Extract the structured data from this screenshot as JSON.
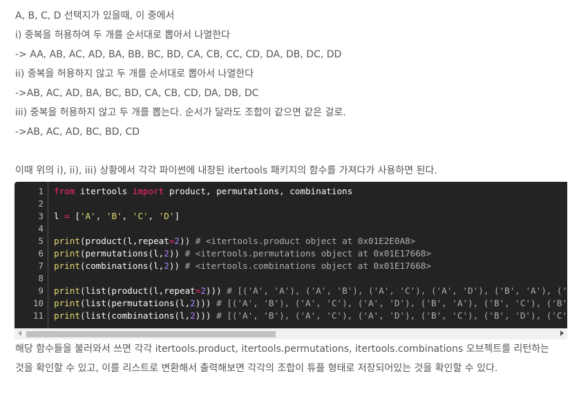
{
  "paragraphs": [
    "A, B, C, D 선택지가 있을때, 이 중에서",
    "i) 중복을 허용하여 두 개를 순서대로 뽑아서 나열한다",
    "-> AA, AB, AC, AD, BA, BB, BC, BD, CA, CB, CC, CD, DA, DB, DC, DD",
    "ii) 중복을 허용하지 않고 두 개를 순서대로 뽑아서 나열한다",
    "->AB, AC, AD, BA, BC, BD, CA, CB, CD, DA, DB, DC",
    "iii) 중복을 허용하지 않고 두 개를 뽑는다. 순서가 달라도 조합이 같으면 같은 걸로.",
    "->AB, AC, AD, BC, BD, CD",
    "이때 위의 i), ii), iii) 상황에서 각각 파이썬에 내장된 itertools 패키지의 함수를 가져다가 사용하면 된다."
  ],
  "code": {
    "line_numbers": [
      "1",
      "2",
      "3",
      "4",
      "5",
      "6",
      "7",
      "8",
      "9",
      "10",
      "11"
    ],
    "l1": {
      "kw_from": "from",
      "mod": " itertools ",
      "kw_import": "import",
      "rest": " product, permutations, combinations"
    },
    "l3": {
      "var": "l ",
      "eq": "=",
      "open": " [",
      "a": "'A'",
      "c1": ", ",
      "b": "'B'",
      "c2": ", ",
      "c": "'C'",
      "c3": ", ",
      "d": "'D'",
      "close": "]"
    },
    "l5": {
      "print": "print",
      "call": "(product(l,repeat",
      "eq": "=",
      "num": "2",
      "close": ")) ",
      "comment": "# <itertools.product object at 0x01E2E0A8>"
    },
    "l6": {
      "print": "print",
      "call": "(permutations(l,",
      "num": "2",
      "close": ")) ",
      "comment": "# <itertools.permutations object at 0x01E17668>"
    },
    "l7": {
      "print": "print",
      "call": "(combinations(l,",
      "num": "2",
      "close": ")) ",
      "comment": "# <itertools.combinations object at 0x01E17668>"
    },
    "l9": {
      "print": "print",
      "call": "(list(product(l,repeat",
      "eq": "=",
      "num": "2",
      "close": "))) ",
      "comment": "# [('A', 'A'), ('A', 'B'), ('A', 'C'), ('A', 'D'), ('B', 'A'), ('B"
    },
    "l10": {
      "print": "print",
      "call": "(list(permutations(l,",
      "num": "2",
      "close": "))) ",
      "comment": "# [('A', 'B'), ('A', 'C'), ('A', 'D'), ('B', 'A'), ('B', 'C'), ('B',"
    },
    "l11": {
      "print": "print",
      "call": "(list(combinations(l,",
      "num": "2",
      "close": "))) ",
      "comment": "# [('A', 'B'), ('A', 'C'), ('A', 'D'), ('B', 'C'), ('B', 'D'), ('C',"
    }
  },
  "after_paragraphs": [
    "해당 함수들을 불러와서 쓰면 각각 itertools.product, itertools.permutations, itertools.combinations 오브젝트를 리턴하는",
    "것을 확인할 수 있고, 이를 리스트로 변환해서 출력해보면 각각의 조합이 튜플 형태로 저장되어있는 것을 확인할 수 있다."
  ],
  "colors": {
    "text": "#555555",
    "code_bg": "#232323",
    "keyword": "#f92672",
    "string": "#e6db74",
    "number": "#ae81ff",
    "comment": "#b0b0b0",
    "default_code": "#f8f8f2"
  }
}
